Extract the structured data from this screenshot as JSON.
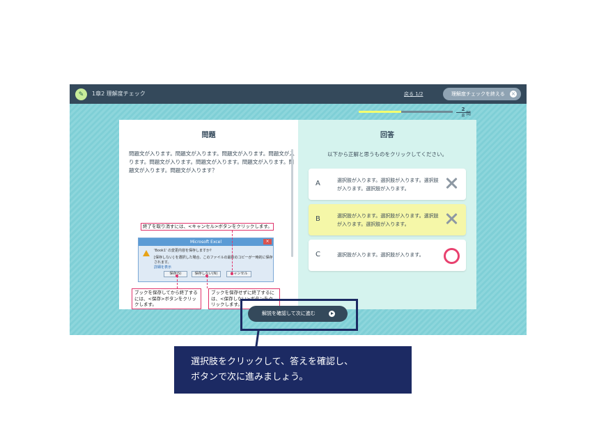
{
  "header": {
    "crumb": "1章2 理解度チェック",
    "back_link": "戻る 1/2",
    "end_button": "理解度チェックを終える",
    "close_icon": "×"
  },
  "progress": {
    "current": "2",
    "total": "8",
    "unit": "問",
    "fraction": 0.45
  },
  "question": {
    "title": "問題",
    "text": "問題文が入ります。問題文が入ります。問題文が入ります。問題文が入ります。問題文が入ります。問題文が入ります。問題文が入ります。問題文が入ります。問題文が入ります？",
    "figure": {
      "callout_top": "終了を取り消すには、<キャンセル>ボタンをクリックします。",
      "dialog_title": "Microsoft Excel",
      "dialog_msg_1": "'Book1' の変更内容を保存しますか?",
      "dialog_msg_2": "[保存しない] を選択した場合、このファイルの最新のコピーが一時的に保存されます。",
      "dialog_msg_3": "詳細を表示",
      "btn_save": "保存(S)",
      "btn_dont_save": "保存しない(N)",
      "btn_cancel": "キャンセル",
      "callout_left": "ブックを保存してから終了するには、<保存>ボタンをクリックします。",
      "callout_right": "ブックを保存せずに終了するには、<保存しない>ボタンをクリックします。"
    }
  },
  "answer": {
    "title": "回答",
    "instruction": "以下から正解と思うものをクリックしてください。",
    "choices": [
      {
        "letter": "A",
        "text": "選択肢が入ります。選択肢が入ります。選択肢が入ります。選択肢が入ります。",
        "mark": "incorrect"
      },
      {
        "letter": "B",
        "text": "選択肢が入ります。選択肢が入ります。選択肢が入ります。選択肢が入ります。",
        "mark": "incorrect"
      },
      {
        "letter": "C",
        "text": "選択肢が入ります。選択肢が入ります。",
        "mark": "correct"
      }
    ]
  },
  "next_button": {
    "label": "解説を確認して次に進む"
  },
  "tip": {
    "line1": "選択肢をクリックして、答えを確認し、",
    "line2": "ボタンで次に進みましょう。"
  }
}
